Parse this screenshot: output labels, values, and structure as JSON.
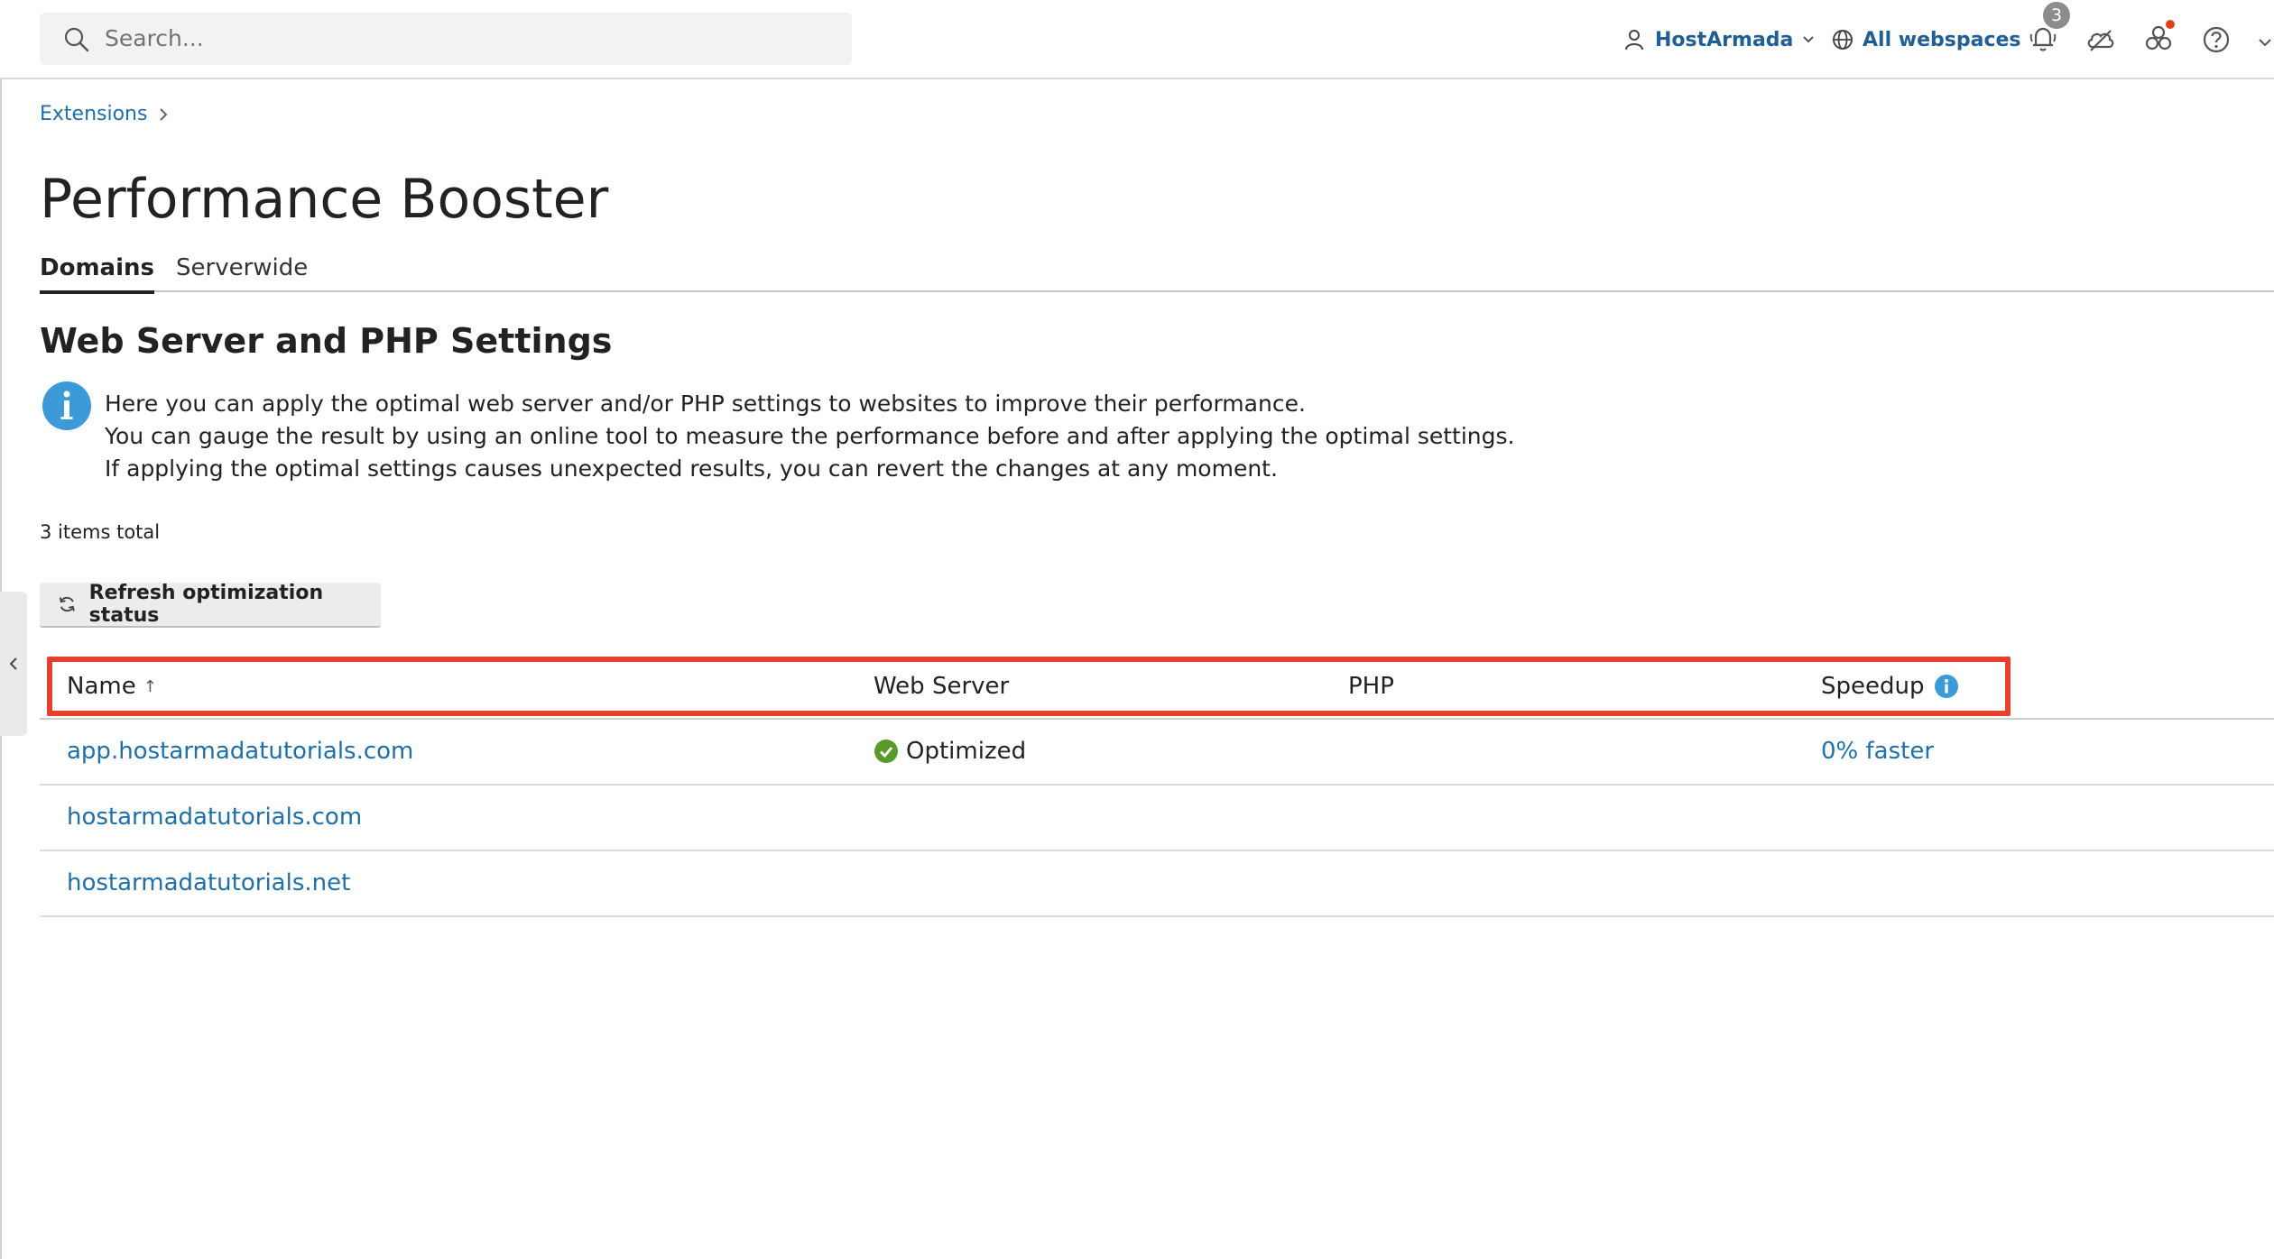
{
  "search": {
    "placeholder": "Search..."
  },
  "topbar": {
    "user_label": "HostArmada",
    "webspaces_label": "All webspaces",
    "notifications_count": "3"
  },
  "breadcrumb": {
    "item": "Extensions"
  },
  "page": {
    "title": "Performance Booster"
  },
  "tabs": [
    {
      "label": "Domains",
      "active": true
    },
    {
      "label": "Serverwide",
      "active": false
    }
  ],
  "section": {
    "title": "Web Server and PHP Settings"
  },
  "info": {
    "lines": [
      "Here you can apply the optimal web server and/or PHP settings to websites to improve their performance.",
      "You can gauge the result by using an online tool to measure the performance before and after applying the optimal settings.",
      "If applying the optimal settings causes unexpected results, you can revert the changes at any moment."
    ]
  },
  "items_total": "3 items total",
  "refresh_button": "Refresh optimization status",
  "table": {
    "columns": [
      "Name",
      "Web Server",
      "PHP",
      "Speedup"
    ],
    "rows": [
      {
        "name": "app.hostarmadatutorials.com",
        "web_server": "Optimized",
        "php": "",
        "speedup": "0% faster"
      },
      {
        "name": "hostarmadatutorials.com",
        "web_server": "",
        "php": "",
        "speedup": ""
      },
      {
        "name": "hostarmadatutorials.net",
        "web_server": "",
        "php": "",
        "speedup": ""
      }
    ]
  },
  "colors": {
    "link": "#1f6fa8",
    "highlight": "#e8402f",
    "success": "#5a9a2a",
    "info": "#3d9ad8"
  }
}
